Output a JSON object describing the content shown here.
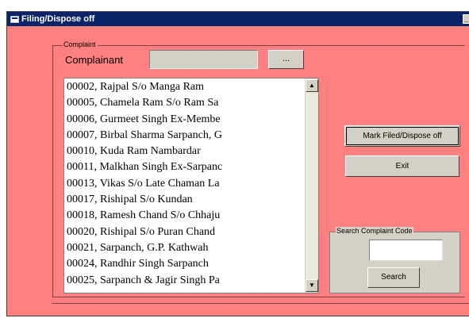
{
  "window": {
    "title": "Filing/Dispose off",
    "minimize_label": "_"
  },
  "complaint_group": {
    "label": "Complaint",
    "complainant_label": "Complainant",
    "complainant_value": "",
    "browse_button_label": "..."
  },
  "complaints_list": {
    "items": [
      "00002, Rajpal S/o Manga Ram",
      "00005, Chamela Ram S/o Ram Sa",
      "00006, Gurmeet Singh Ex-Membe",
      "00007, Birbal Sharma Sarpanch, G",
      "00010, Kuda Ram Nambardar",
      "00011, Malkhan Singh Ex-Sarpanc",
      "00013, Vikas S/o Late Chaman La",
      "00017, Rishipal S/o Kundan",
      "00018, Ramesh Chand S/o Chhaju",
      "00020, Rishipal S/o Puran Chand",
      "00021, Sarpanch, G.P. Kathwah",
      "00024, Randhir Singh Sarpanch",
      "00025, Sarpanch & Jagir Singh Pa"
    ]
  },
  "actions": {
    "mark_label": "Mark Filed/Dispose off",
    "exit_label": "Exit"
  },
  "search": {
    "group_label": "Search Complaint Code",
    "input_value": "",
    "button_label": "Search"
  },
  "colors": {
    "form_background": "#ff8080",
    "titlebar": "#0a246a",
    "button_face": "#d4d0c8"
  }
}
